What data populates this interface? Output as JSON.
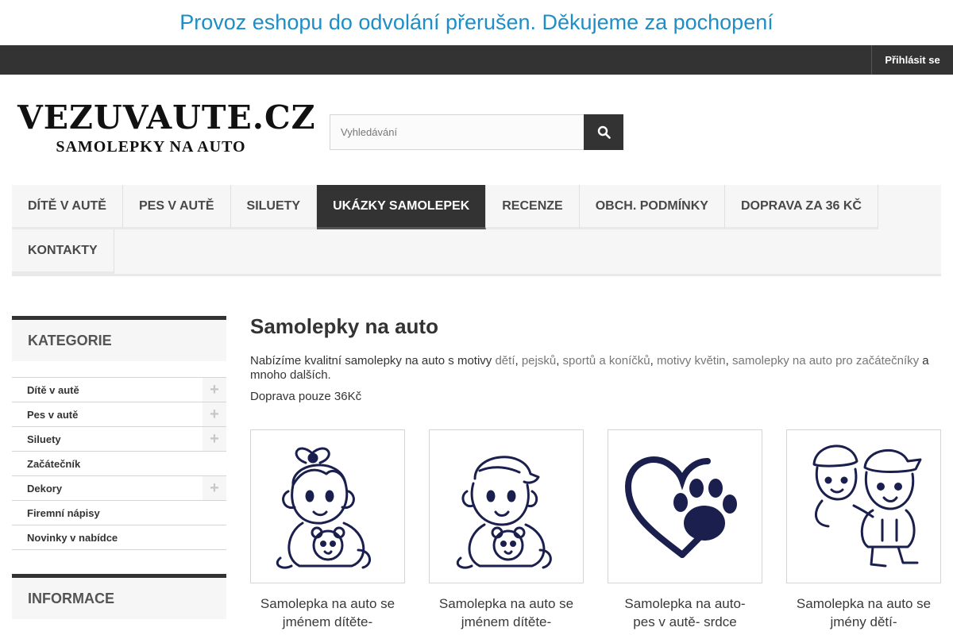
{
  "notice": "Provoz eshopu do odvolání přerušen. Děkujeme za pochopení",
  "topbar": {
    "login_label": "Přihlásit se"
  },
  "logo": {
    "line1": "VEZUVAUTE.CZ",
    "line2": "SAMOLEPKY NA AUTO"
  },
  "search": {
    "placeholder": "Vyhledávání",
    "icon": "search-icon"
  },
  "menu": {
    "items": [
      {
        "label": "DÍTĚ V AUTĚ"
      },
      {
        "label": "PES V AUTĚ"
      },
      {
        "label": "SILUETY"
      },
      {
        "label": "UKÁZKY SAMOLEPEK",
        "active": true
      },
      {
        "label": "RECENZE"
      },
      {
        "label": "OBCH. PODMÍNKY"
      },
      {
        "label": "DOPRAVA ZA 36 KČ"
      },
      {
        "label": "KONTAKTY"
      }
    ]
  },
  "sidebar": {
    "categories_title": "KATEGORIE",
    "categories": [
      {
        "label": "Dítě v autě",
        "expandable": true
      },
      {
        "label": "Pes v autě",
        "expandable": true
      },
      {
        "label": "Siluety",
        "expandable": true
      },
      {
        "label": "Začátečník",
        "expandable": false
      },
      {
        "label": "Dekory",
        "expandable": true
      },
      {
        "label": "Firemní nápisy",
        "expandable": false
      },
      {
        "label": "Novinky v nabídce",
        "expandable": false
      }
    ],
    "expand_symbol": "+",
    "info_title": "INFORMACE"
  },
  "main": {
    "title": "Samolepky na auto",
    "intro": {
      "prefix": "Nabízíme kvalitní samolepky na auto s motivy ",
      "link1": "dětí",
      "sep1": ", ",
      "link2": "pejsků",
      "sep2": ", ",
      "link3": "sportů a koníčků",
      "sep3": ", ",
      "link4": "motivy květin",
      "sep4": ", ",
      "link5": "samolepky na auto pro začátečníky",
      "suffix": " a mnoho dalších."
    },
    "shipping": "Doprava pouze 36Kč",
    "products": [
      {
        "name": "Samolepka na auto se jménem dítěte-",
        "image": "girl-with-teddy-icon"
      },
      {
        "name": "Samolepka na auto se jménem dítěte-",
        "image": "boy-with-teddy-icon"
      },
      {
        "name": "Samolepka na auto- pes v autě- srdce",
        "image": "heart-paw-icon"
      },
      {
        "name": "Samolepka na auto se jmény dětí-",
        "image": "two-kids-icon"
      }
    ]
  },
  "colors": {
    "accent": "#1f8ec7",
    "dark": "#333333",
    "light_bg": "#f6f6f6",
    "sticker": "#1a1f4d"
  }
}
